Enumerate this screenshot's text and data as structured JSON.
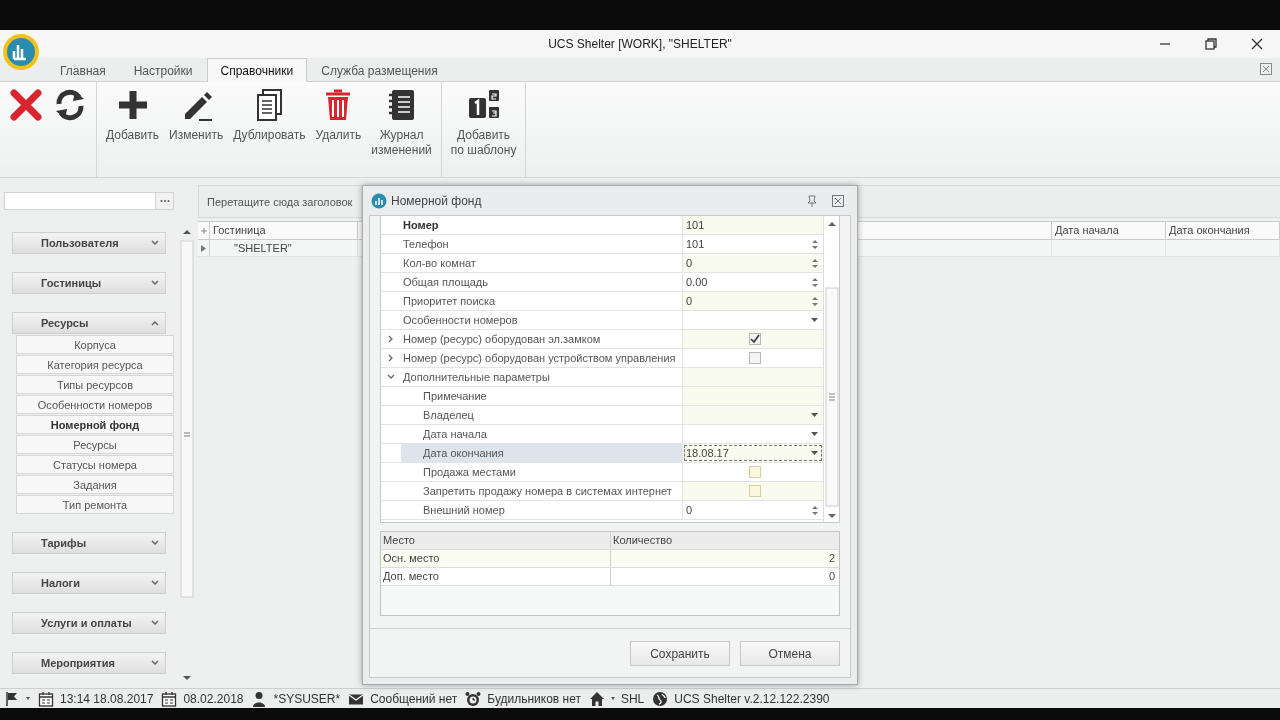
{
  "window": {
    "title": "UCS Shelter [WORK], \"SHELTER\""
  },
  "tabs": [
    {
      "label": "Главная",
      "selected": false
    },
    {
      "label": "Настройки",
      "selected": false
    },
    {
      "label": "Справочники",
      "selected": true
    },
    {
      "label": "Служба размещения",
      "selected": false
    }
  ],
  "toolbar": {
    "groups": [
      {
        "buttons": [
          {
            "kind": "close"
          },
          {
            "kind": "refresh"
          }
        ]
      },
      {
        "buttons": [
          {
            "kind": "add",
            "label": "Добавить"
          },
          {
            "kind": "edit",
            "label": "Изменить"
          },
          {
            "kind": "duplicate",
            "label": "Дублировать"
          },
          {
            "kind": "delete",
            "label": "Удалить"
          },
          {
            "kind": "journal",
            "label": "Журнал\nизменений"
          }
        ]
      },
      {
        "buttons": [
          {
            "kind": "template",
            "label": "Добавить\nпо шаблону"
          }
        ]
      }
    ]
  },
  "sidebar": {
    "groups": [
      {
        "label": "Пользователя",
        "expanded": false
      },
      {
        "label": "Гостиницы",
        "expanded": false
      },
      {
        "label": "Ресурсы",
        "expanded": true,
        "items": [
          {
            "label": "Корпуса",
            "selected": false
          },
          {
            "label": "Категория ресурса",
            "selected": false
          },
          {
            "label": "Типы ресурсов",
            "selected": false
          },
          {
            "label": "Особенности номеров",
            "selected": false
          },
          {
            "label": "Номерной фонд",
            "selected": true
          },
          {
            "label": "Ресурсы",
            "selected": false
          },
          {
            "label": "Статусы номера",
            "selected": false
          },
          {
            "label": "Задания",
            "selected": false
          },
          {
            "label": "Тип ремонта",
            "selected": false
          }
        ]
      },
      {
        "label": "Тарифы",
        "expanded": false
      },
      {
        "label": "Налоги",
        "expanded": false
      },
      {
        "label": "Услуги и оплаты",
        "expanded": false
      },
      {
        "label": "Мероприятия",
        "expanded": false
      }
    ]
  },
  "grid": {
    "group_panel_hint": "Перетащите сюда заголовок",
    "columns": [
      "Гостиница",
      "Дата начала",
      "Дата окончания"
    ],
    "rows": [
      {
        "cells": [
          "\"SHELTER\""
        ]
      }
    ]
  },
  "dialog": {
    "title": "Номерной фонд",
    "properties": [
      {
        "label": "Номер",
        "kind": "text",
        "value": "101",
        "bold": true,
        "selected": false
      },
      {
        "label": "Телефон",
        "kind": "spin",
        "value": "101",
        "selected": false
      },
      {
        "label": "Кол-во комнат",
        "kind": "spin",
        "value": "0",
        "selected": false
      },
      {
        "label": "Общая площадь",
        "kind": "spin",
        "value": "0.00",
        "selected": false
      },
      {
        "label": "Приоритет поиска",
        "kind": "spin",
        "value": "0",
        "selected": false
      },
      {
        "label": "Особенности номеров",
        "kind": "dropdown",
        "selected": false
      },
      {
        "label": "Номер (ресурс) оборудован эл.замком",
        "kind": "checkbox",
        "checked": true,
        "expanded": false,
        "selected": false
      },
      {
        "label": "Номер (ресурс) оборудован устройством управления",
        "kind": "checkbox",
        "checked": false,
        "expanded": false,
        "selected": false
      },
      {
        "label": "Дополнительные параметры",
        "kind": "group",
        "expanded": true,
        "selected": false,
        "children": [
          {
            "label": "Примечание",
            "kind": "text",
            "selected": false
          },
          {
            "label": "Владелец",
            "kind": "dropdown",
            "selected": false
          },
          {
            "label": "Дата начала",
            "kind": "dropdown",
            "selected": false
          },
          {
            "label": "Дата окончания",
            "kind": "dropdown",
            "value": "18.08.17",
            "selected": true
          },
          {
            "label": "Продажа местами",
            "kind": "checkbox",
            "checked": false,
            "selected": false
          },
          {
            "label": "Запретить продажу номера в системах интернет",
            "kind": "checkbox",
            "checked": false,
            "selected": false
          },
          {
            "label": "Внешний номер",
            "kind": "spin",
            "value": "0",
            "selected": false
          }
        ]
      }
    ],
    "seats_table": {
      "columns": [
        "Место",
        "Количество"
      ],
      "rows": [
        [
          "Осн. место",
          "2"
        ],
        [
          "Доп. место",
          "0"
        ]
      ]
    },
    "buttons": [
      "Сохранить",
      "Отмена"
    ]
  },
  "status_bar": [
    {
      "kind": "flag",
      "caret": true
    },
    {
      "kind": "calendar",
      "text": "13:14 18.08.2017"
    },
    {
      "kind": "calendar",
      "text": "08.02.2018"
    },
    {
      "kind": "user",
      "text": "*SYSUSER*"
    },
    {
      "kind": "mail",
      "text": "Сообщений нет"
    },
    {
      "kind": "alarm",
      "text": "Будильников нет"
    },
    {
      "kind": "home",
      "caret": true,
      "text": "SHL"
    },
    {
      "kind": "globe",
      "text": "UCS Shelter v.2.12.122.2390"
    }
  ]
}
